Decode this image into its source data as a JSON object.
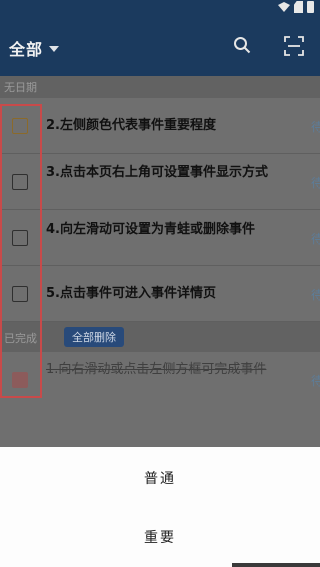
{
  "header": {
    "title": "全部"
  },
  "sections": {
    "undated_label": "无日期",
    "completed_label": "已完成",
    "delete_all_label": "全部删除"
  },
  "items": [
    {
      "text": "2.左侧颜色代表事件重要程度",
      "status": "待"
    },
    {
      "text": "3.点击本页右上角可设置事件显示方式",
      "status": "待"
    },
    {
      "text": "4.向左滑动可设置为青蛙或删除事件",
      "status": "待"
    },
    {
      "text": "5.点击事件可进入事件详情页",
      "status": "待"
    }
  ],
  "completed_items": [
    {
      "text": "1.向右滑动或点击左侧方框可完成事件",
      "status": "待"
    }
  ],
  "sheet": {
    "options": [
      "普通",
      "重要"
    ]
  },
  "colors": {
    "appbar": "#1b3a5e",
    "accent": "#284a7a",
    "highlight": "#c84a4a"
  },
  "icons": [
    "wifi-icon",
    "sim-icon",
    "battery-icon",
    "search-icon",
    "scan-icon",
    "chevron-down-icon"
  ]
}
